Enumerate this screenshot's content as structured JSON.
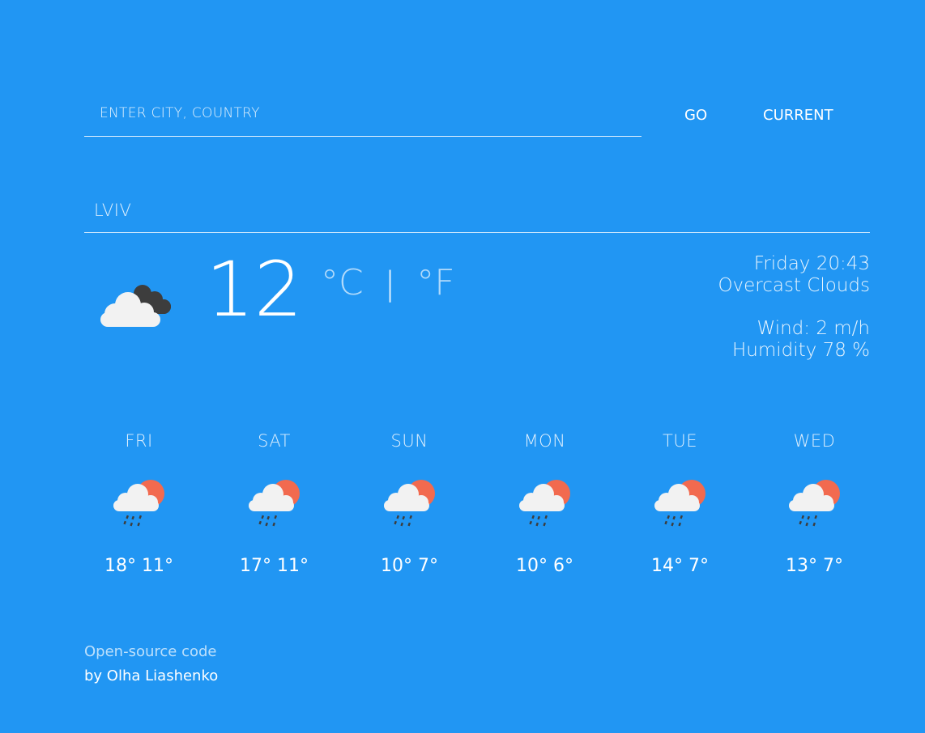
{
  "search": {
    "placeholder": "ENTER CITY, COUNTRY",
    "go_label": "GO",
    "current_label": "CURRENT"
  },
  "city": "LVIV",
  "current": {
    "temperature": "12",
    "unit_c": "°C",
    "separator": "|",
    "unit_f": "°F",
    "icon": "cloud-overcast-icon",
    "day_time": "Friday 20:43",
    "description": "Overcast Clouds",
    "wind": "Wind: 2 m/h",
    "humidity": "Humidity 78 %"
  },
  "forecast": [
    {
      "day": "FRI",
      "temps": "18° 11°",
      "icon": "rain-sun-icon"
    },
    {
      "day": "SAT",
      "temps": "17° 11°",
      "icon": "rain-sun-icon"
    },
    {
      "day": "SUN",
      "temps": "10° 7°",
      "icon": "rain-sun-icon"
    },
    {
      "day": "MON",
      "temps": "10° 6°",
      "icon": "rain-sun-icon"
    },
    {
      "day": "TUE",
      "temps": "14° 7°",
      "icon": "rain-sun-icon"
    },
    {
      "day": "WED",
      "temps": "13° 7°",
      "icon": "rain-sun-icon"
    }
  ],
  "footer": {
    "link_text": "Open-source code",
    "author": "by Olha Liashenko"
  },
  "colors": {
    "background": "#2196f3",
    "sun": "#f26a4f",
    "cloud": "#f2f2f2",
    "dark_cloud": "#3d3d3d"
  }
}
